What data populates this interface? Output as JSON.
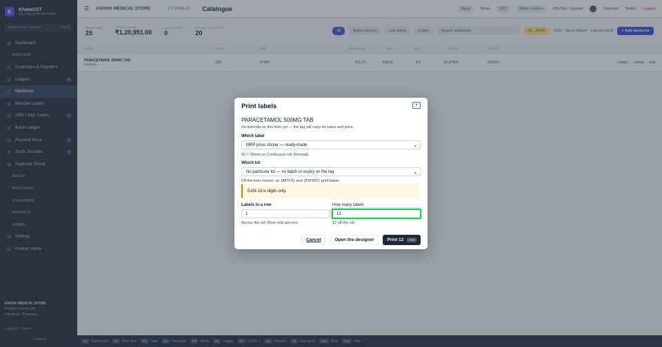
{
  "sidebar": {
    "brand_letter": "K",
    "brand_name": "KhataGST",
    "brand_sub": "BILLING & INVENTORY",
    "search_placeholder": "Quick jump / search",
    "search_shortcut": "Ctrl K",
    "items": [
      {
        "label": "Dashboard",
        "type": "item"
      },
      {
        "label": "MASTERS",
        "type": "section"
      },
      {
        "label": "Customers & Suppliers",
        "type": "item"
      },
      {
        "label": "Ledgers",
        "type": "item",
        "badge": "+"
      },
      {
        "label": "Medicines",
        "type": "active"
      },
      {
        "label": "Barcode Labels",
        "type": "item"
      },
      {
        "label": "HSN / SAC Codes",
        "type": "item",
        "badge": "+"
      },
      {
        "label": "Batch Ledger",
        "type": "item"
      },
      {
        "label": "Physical Stock",
        "type": "item",
        "badge": "+"
      },
      {
        "label": "Stock Journals",
        "type": "item",
        "badge": "+"
      },
      {
        "label": "Duplicate Check",
        "type": "item"
      },
      {
        "label": "SALES",
        "type": "section"
      },
      {
        "label": "PURCHASE",
        "type": "section"
      },
      {
        "label": "VOUCHERS",
        "type": "section"
      },
      {
        "label": "REPORTS",
        "type": "section"
      },
      {
        "label": "ADMIN",
        "type": "section"
      },
      {
        "label": "Settings",
        "type": "item"
      },
      {
        "label": "Product Home",
        "type": "item"
      }
    ],
    "store_name": "ASHOK MEDICAL STORE",
    "store_gstin": "27AABCA1234F1Z5",
    "store_status": "Medical / Pharmacy",
    "foot": "Logged in: Owner",
    "foot2": "Collapse"
  },
  "topbar": {
    "store": "ASHOK MEDICAL STORE",
    "fy": "FY 2026-27",
    "title": "Catalogue",
    "right": [
      "Apply",
      "Stock",
      "GST",
      "Multi-Location",
      "ONLINE - Synced"
    ],
    "user": "Operator",
    "switch": "Switch",
    "logout": "Logout"
  },
  "stats": [
    {
      "label": "Medicines",
      "value": "25"
    },
    {
      "label": "Stock Value",
      "value": "₹1,20,951.00"
    },
    {
      "label": "Low Stock",
      "value": "0"
    },
    {
      "label": "Expiry in 90 days",
      "value": "20"
    }
  ],
  "filters": {
    "chips": [
      "All",
      "Batch tracked",
      "Low stock",
      "Expiry"
    ],
    "category": "Search medicines",
    "warn_chip": "GL_ABSR",
    "buttons": [
      "CSV",
      "Excel Import",
      "Upload Excel"
    ],
    "primary": "+ Add medicine"
  },
  "table": {
    "headers": [
      "Name",
      "Pack",
      "Unit",
      "Purchase",
      "MRP",
      "GST",
      "Stock",
      "Expiry"
    ],
    "rows": [
      {
        "name": "PARACETAMOL 500MG TAB",
        "tag": "Medicine",
        "pack": "10S",
        "unit": "STRIP",
        "purchase": "₹11.23",
        "mrp": "₹18.00",
        "gst": "5%",
        "stock": "20 STRIP",
        "expiry": "06/2027",
        "actions": [
          "Ledger",
          "Labels",
          "Edit"
        ]
      }
    ]
  },
  "bottombar": [
    {
      "key": "F1",
      "label": "Dashboard"
    },
    {
      "key": "F2",
      "label": "New Sale"
    },
    {
      "key": "F3",
      "label": "Sale"
    },
    {
      "key": "F4",
      "label": "Purchase"
    },
    {
      "key": "F5",
      "label": "Stock"
    },
    {
      "key": "F6",
      "label": "Ledger"
    },
    {
      "key": "F7",
      "label": "GSTR-1"
    },
    {
      "key": "F8",
      "label": "Reports"
    },
    {
      "key": "F9",
      "label": "Day Book"
    },
    {
      "key": "F10",
      "label": "Print"
    },
    {
      "key": "F12",
      "label": "Help"
    }
  ],
  "modal": {
    "title": "Print labels",
    "close": "×",
    "item_name": "PARACETAMOL 500MG TAB",
    "item_hint": "No barcode on this item yet — the tag will carry its name and price.",
    "label_field": "Which label",
    "label_value": "MRP price sticker — ready-made",
    "label_hint": "50 × 25mm on Continuous roll (thermal).",
    "lot_field": "Which lot",
    "lot_value": "No particular lot — no batch or expiry on the tag",
    "lot_hint_1": "Off the item master, so ",
    "lot_hint_code1": "{BATCH}",
    "lot_hint_2": " and ",
    "lot_hint_code2": "{EXPIRY}",
    "lot_hint_3": " print blank.",
    "warning": "EAN-13 is digits only.",
    "row_field": "Labels in a row",
    "row_value": "1",
    "row_hint": "Across the roll. Most rolls are one.",
    "count_field": "How many labels",
    "count_value": "12",
    "count_hint": "12 off the roll.",
    "cancel": "Cancel",
    "designer": "Open the designer",
    "print": "Print 12",
    "print_key": "F10"
  }
}
